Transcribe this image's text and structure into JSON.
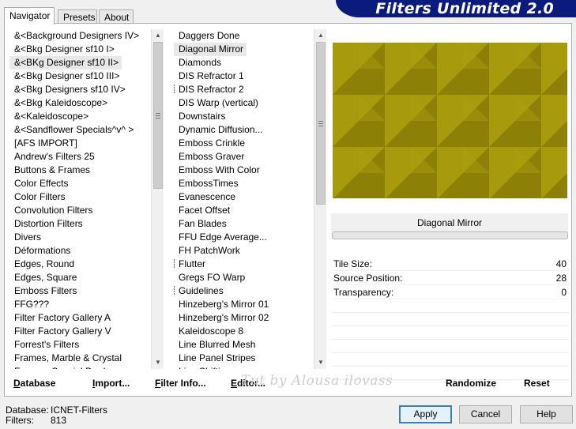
{
  "banner": {
    "title": "Filters Unlimited 2.0"
  },
  "tabs": [
    {
      "label": "Navigator"
    },
    {
      "label": "Presets"
    },
    {
      "label": "About"
    }
  ],
  "categories": [
    "&<Background Designers IV>",
    "&<Bkg Designer sf10 I>",
    "&<BKg Designer sf10 II>",
    "&<Bkg Designer sf10 III>",
    "&<Bkg Designers sf10 IV>",
    "&<Bkg Kaleidoscope>",
    "&<Kaleidoscope>",
    "&<Sandflower Specials^v^ >",
    "[AFS IMPORT]",
    "Andrew's Filters 25",
    "Buttons & Frames",
    "Color Effects",
    "Color Filters",
    "Convolution Filters",
    "Distortion Filters",
    "Divers",
    "Déformations",
    "Edges, Round",
    "Edges, Square",
    "Emboss Filters",
    "FFG???",
    "Filter Factory Gallery A",
    "Filter Factory Gallery V",
    "Forrest's Filters",
    "Frames, Marble & Crystal",
    "Frames, Special Borders"
  ],
  "categories_selected_index": 2,
  "filters": [
    {
      "label": "Daggers Done",
      "marked": false
    },
    {
      "label": "Diagonal Mirror",
      "marked": false
    },
    {
      "label": "Diamonds",
      "marked": false
    },
    {
      "label": "DIS Refractor 1",
      "marked": false
    },
    {
      "label": "DIS Refractor 2",
      "marked": true
    },
    {
      "label": "DIS Warp (vertical)",
      "marked": false
    },
    {
      "label": "Downstairs",
      "marked": false
    },
    {
      "label": "Dynamic Diffusion...",
      "marked": false
    },
    {
      "label": "Emboss Crinkle",
      "marked": false
    },
    {
      "label": "Emboss Graver",
      "marked": false
    },
    {
      "label": "Emboss With Color",
      "marked": false
    },
    {
      "label": "EmbossTimes",
      "marked": false
    },
    {
      "label": "Evanescence",
      "marked": false
    },
    {
      "label": "Facet Offset",
      "marked": false
    },
    {
      "label": "Fan Blades",
      "marked": false
    },
    {
      "label": "FFU Edge Average...",
      "marked": false
    },
    {
      "label": "FH PatchWork",
      "marked": false
    },
    {
      "label": "Flutter",
      "marked": true
    },
    {
      "label": "Gregs FO Warp",
      "marked": false
    },
    {
      "label": "Guidelines",
      "marked": true
    },
    {
      "label": "Hinzeberg's Mirror 01",
      "marked": false
    },
    {
      "label": "Hinzeberg's Mirror 02",
      "marked": false
    },
    {
      "label": "Kaleidoscope 8",
      "marked": false
    },
    {
      "label": "Line Blurred Mesh",
      "marked": false
    },
    {
      "label": "Line Panel Stripes",
      "marked": false
    },
    {
      "label": "Line Shifting",
      "marked": false
    }
  ],
  "filters_selected_index": 1,
  "preview": {
    "filter_name": "Diagonal Mirror",
    "colors": {
      "base": "#9a8e08",
      "light": "#b2a410",
      "dark": "#7d7205"
    }
  },
  "params": [
    {
      "label": "Tile Size:",
      "value": "40"
    },
    {
      "label": "Source Position:",
      "value": "28"
    },
    {
      "label": "Transparency:",
      "value": "0"
    }
  ],
  "toolbar": {
    "database": {
      "first": "D",
      "rest": "atabase"
    },
    "import": {
      "first": "I",
      "rest": "mport..."
    },
    "filter_info": {
      "first": "F",
      "rest": "ilter Info..."
    },
    "editor": {
      "first": "E",
      "rest": "ditor..."
    },
    "randomize": "Randomize",
    "reset": "Reset"
  },
  "watermark": "Tut by Alousa ilovass",
  "footer": {
    "database_label": "Database:",
    "database_value": "ICNET-Filters",
    "filters_label": "Filters:",
    "filters_value": "813",
    "apply": "Apply",
    "cancel": "Cancel",
    "help": "Help"
  }
}
